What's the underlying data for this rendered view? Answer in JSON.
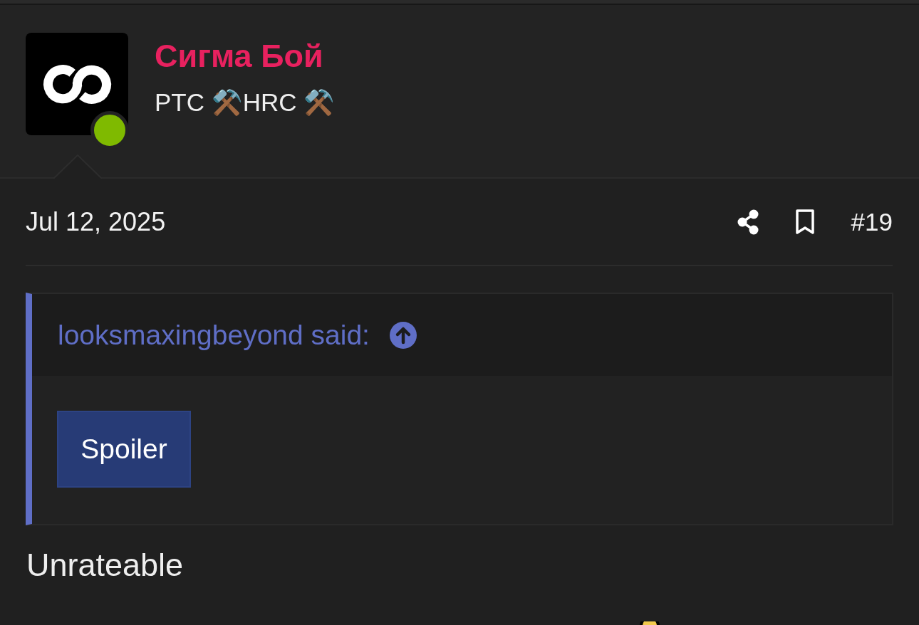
{
  "post": {
    "author": {
      "name": "Сигма Бой",
      "title": "PTC ⚒️HRC ⚒️",
      "online": true
    },
    "date": "Jul 12, 2025",
    "bookmarked": false,
    "number": "#19",
    "quote": {
      "author_line": "looksmaxingbeyond said:",
      "spoiler": {
        "label": "Spoiler"
      }
    },
    "body": "Unrateable"
  }
}
